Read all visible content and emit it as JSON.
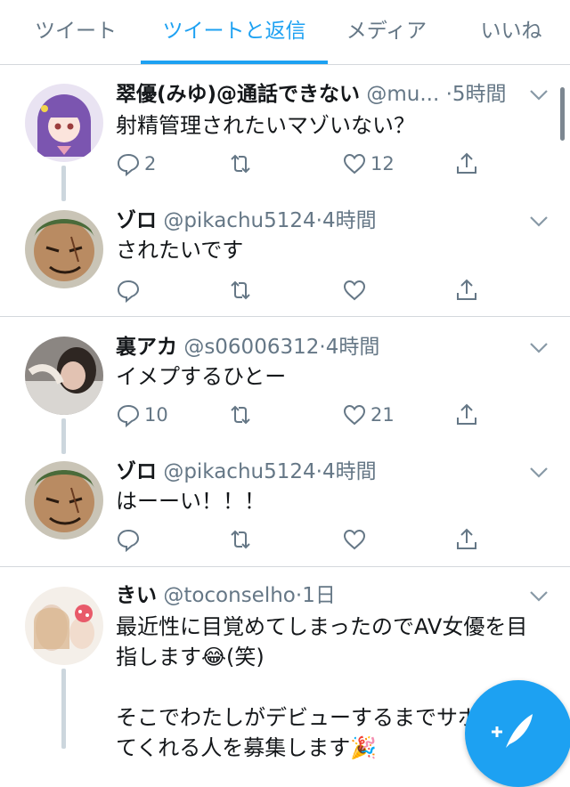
{
  "tabs": [
    {
      "label": "ツイート"
    },
    {
      "label": "ツイートと返信"
    },
    {
      "label": "メディア"
    },
    {
      "label": "いいね"
    }
  ],
  "active_tab_index": 1,
  "colors": {
    "accent": "#1da1f2",
    "muted": "#657786",
    "text": "#14171a",
    "divider": "#d4d8dc"
  },
  "tweets": [
    {
      "name": "翠優(みゆ)@通話できない",
      "handle": "@mu...",
      "time": "5時間",
      "text": "射精管理されたいマゾいない？",
      "replies": "2",
      "likes": "12"
    },
    {
      "name": "ゾロ",
      "handle": "@pikachu5124",
      "time": "4時間",
      "text": "されたいです",
      "replies": "",
      "likes": ""
    },
    {
      "name": "裏アカ",
      "handle": "@s06006312",
      "time": "4時間",
      "text": "イメプするひとー",
      "replies": "10",
      "likes": "21"
    },
    {
      "name": "ゾロ",
      "handle": "@pikachu5124",
      "time": "4時間",
      "text": "はーーい！！！",
      "replies": "",
      "likes": ""
    },
    {
      "name": "きい",
      "handle": "@toconselho",
      "time": "1日",
      "text": "最近性に目覚めてしまったのでAV女優を目\n指します😂(笑)\n\nそこでわたしがデビューするまでサポ\nてくれる人を募集します🎉",
      "replies": "",
      "likes": ""
    }
  ],
  "separator": "·",
  "icons": [
    "reply-icon",
    "retweet-icon",
    "like-icon",
    "share-icon",
    "chevron-down-icon",
    "compose-icon"
  ]
}
